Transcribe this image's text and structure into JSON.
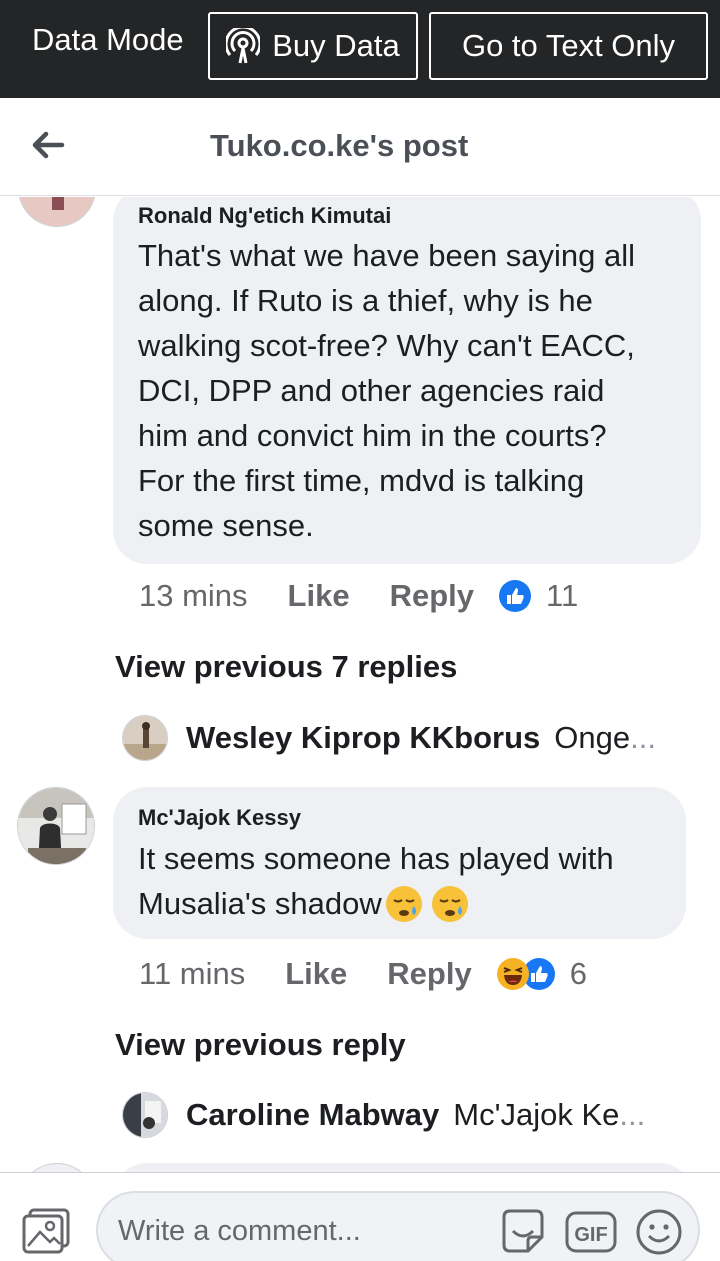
{
  "data_bar": {
    "mode_label": "Data Mode",
    "buy_label": "Buy Data",
    "text_only_label": "Go to Text Only"
  },
  "header": {
    "title": "Tuko.co.ke's post"
  },
  "comments": [
    {
      "author": "Ronald Ng'etich Kimutai",
      "lines": [
        "That's what we have been saying all",
        "along. If Ruto is a thief, why is he",
        "walking scot-free? Why can't EACC,",
        "DCI, DPP and other agencies raid",
        "him and convict him in the courts?",
        "For the first time, mdvd is talking",
        "some sense."
      ],
      "time": "13 mins",
      "like": "Like",
      "reply": "Reply",
      "reaction_count": "11",
      "view_previous": "View previous 7 replies",
      "latest_reply": {
        "name": "Wesley Kiprop KKborus",
        "snippet": "Onge",
        "ellipsis": "..."
      }
    },
    {
      "author": "Mc'Jajok Kessy",
      "lines": [
        "It seems someone has played with",
        "Musalia's shadow"
      ],
      "time": "11 mins",
      "like": "Like",
      "reply": "Reply",
      "reaction_count": "6",
      "view_previous": "View previous reply",
      "latest_reply": {
        "name": "Caroline Mabway",
        "snippet": "Mc'Jajok Ke",
        "ellipsis": "..."
      }
    }
  ],
  "composer": {
    "placeholder": "Write a comment...",
    "gif_label": "GIF"
  },
  "icons": [
    "back-arrow-icon",
    "broadcast-icon",
    "photo-icon",
    "sticker-icon",
    "gif-icon",
    "emoji-icon",
    "like-reaction-icon",
    "haha-reaction-icon",
    "crying-emoji-icon"
  ],
  "colors": {
    "top_bar": "#242526",
    "bubble": "#eef0f3",
    "like_blue": "#1877f2",
    "muted_text": "#65676b"
  }
}
